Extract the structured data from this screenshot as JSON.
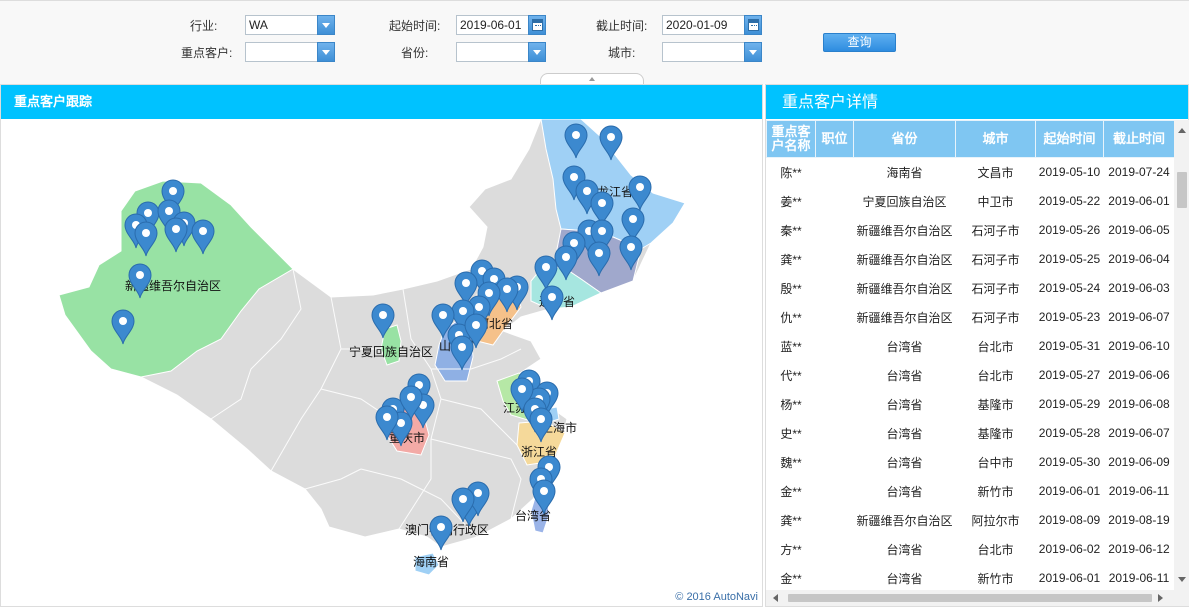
{
  "filters": {
    "industry_label": "行业:",
    "industry_value": "WA",
    "start_label": "起始时间:",
    "start_value": "2019-06-01",
    "end_label": "截止时间:",
    "end_value": "2020-01-09",
    "customer_label": "重点客户:",
    "customer_value": "",
    "province_label": "省份:",
    "province_value": "",
    "city_label": "城市:",
    "city_value": "",
    "query_label": "查询"
  },
  "map_panel": {
    "title": "重点客户跟踪",
    "copyright": "© 2016 AutoNavi",
    "region_labels": {
      "xinjiang": "新疆维吾尔自治区",
      "ningxia": "宁夏回族自治区",
      "heilongjiang": "黑龙江省",
      "liaoning": "辽宁省",
      "hebei": "河北省",
      "shanxi": "山西省",
      "jiangsu": "江苏省",
      "shanghai": "上海市",
      "zhejiang": "浙江省",
      "chongqing": "重庆市",
      "taiwan": "台湾省",
      "macau": "澳门特别行政区",
      "hainan": "海南省"
    },
    "colors": {
      "base_land": "#dcdcdc",
      "xinjiang": "#98e2a4",
      "heilongjiang": "#9fd0f5",
      "jilin": "#a0a8cc",
      "liaoning": "#a6e6e0",
      "hebei": "#f5c18a",
      "shanxi": "#8fb0e4",
      "ningxia": "#98e2a4",
      "jiangsu": "#b6e8a6",
      "shanghai": "#9fd0f5",
      "zhejiang": "#f5d99a",
      "chongqing": "#f3aaa6",
      "taiwan": "#9bb4e8",
      "hainan": "#9fd0f5",
      "marker": "#3c89cf"
    }
  },
  "detail_panel": {
    "title": "重点客户详情",
    "columns": [
      "重点客户名称",
      "职位",
      "省份",
      "城市",
      "起始时间",
      "截止时间"
    ],
    "rows": [
      {
        "name": "陈**",
        "position": "",
        "province": "海南省",
        "city": "文昌市",
        "start": "2019-05-10",
        "end": "2019-07-24"
      },
      {
        "name": "姜**",
        "position": "",
        "province": "宁夏回族自治区",
        "city": "中卫市",
        "start": "2019-05-22",
        "end": "2019-06-01"
      },
      {
        "name": "秦**",
        "position": "",
        "province": "新疆维吾尔自治区",
        "city": "石河子市",
        "start": "2019-05-26",
        "end": "2019-06-05"
      },
      {
        "name": "龚**",
        "position": "",
        "province": "新疆维吾尔自治区",
        "city": "石河子市",
        "start": "2019-05-25",
        "end": "2019-06-04"
      },
      {
        "name": "殷**",
        "position": "",
        "province": "新疆维吾尔自治区",
        "city": "石河子市",
        "start": "2019-05-24",
        "end": "2019-06-03"
      },
      {
        "name": "仇**",
        "position": "",
        "province": "新疆维吾尔自治区",
        "city": "石河子市",
        "start": "2019-05-23",
        "end": "2019-06-07"
      },
      {
        "name": "蓝**",
        "position": "",
        "province": "台湾省",
        "city": "台北市",
        "start": "2019-05-31",
        "end": "2019-06-10"
      },
      {
        "name": "代**",
        "position": "",
        "province": "台湾省",
        "city": "台北市",
        "start": "2019-05-27",
        "end": "2019-06-06"
      },
      {
        "name": "杨**",
        "position": "",
        "province": "台湾省",
        "city": "基隆市",
        "start": "2019-05-29",
        "end": "2019-06-08"
      },
      {
        "name": "史**",
        "position": "",
        "province": "台湾省",
        "city": "基隆市",
        "start": "2019-05-28",
        "end": "2019-06-07"
      },
      {
        "name": "魏**",
        "position": "",
        "province": "台湾省",
        "city": "台中市",
        "start": "2019-05-30",
        "end": "2019-06-09"
      },
      {
        "name": "金**",
        "position": "",
        "province": "台湾省",
        "city": "新竹市",
        "start": "2019-06-01",
        "end": "2019-06-11"
      },
      {
        "name": "龚**",
        "position": "",
        "province": "新疆维吾尔自治区",
        "city": "阿拉尔市",
        "start": "2019-08-09",
        "end": "2019-08-19"
      },
      {
        "name": "方**",
        "position": "",
        "province": "台湾省",
        "city": "台北市",
        "start": "2019-06-02",
        "end": "2019-06-12"
      },
      {
        "name": "金**",
        "position": "",
        "province": "台湾省",
        "city": "新竹市",
        "start": "2019-06-01",
        "end": "2019-06-11"
      }
    ]
  }
}
